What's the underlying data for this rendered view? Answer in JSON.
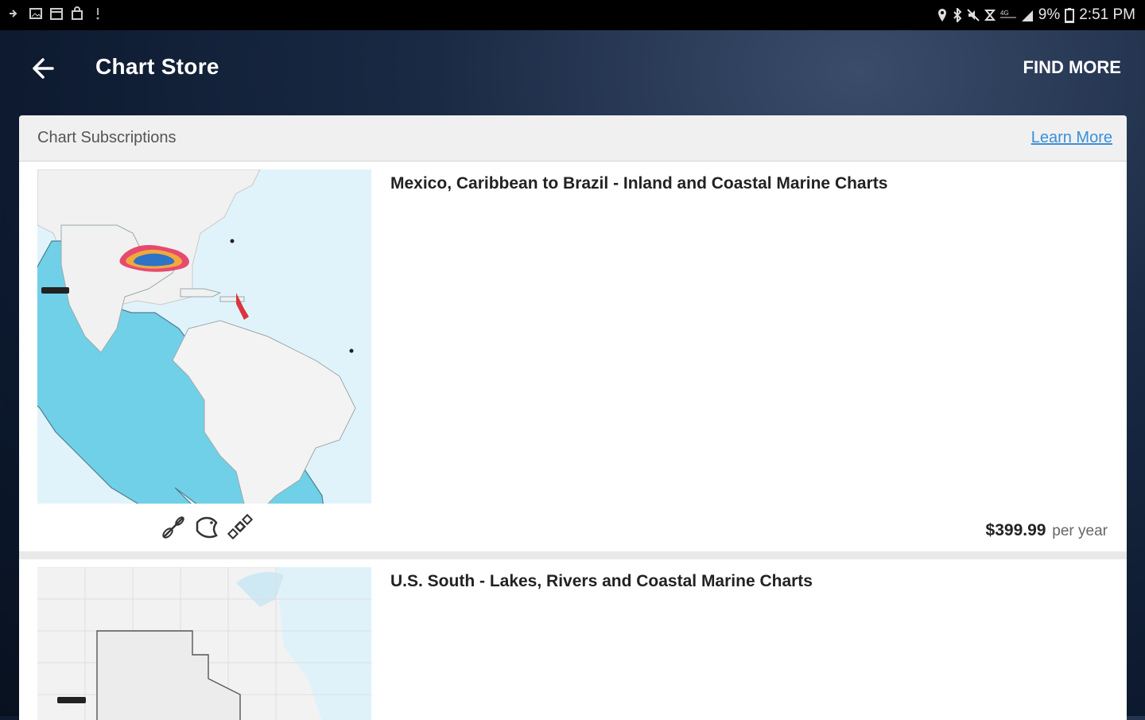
{
  "status_bar": {
    "battery": "9%",
    "time": "2:51 PM"
  },
  "app_bar": {
    "title": "Chart Store",
    "action": "FIND MORE"
  },
  "section": {
    "label": "Chart Subscriptions",
    "link": "Learn More"
  },
  "products": [
    {
      "title": "Mexico, Caribbean to Brazil - Inland and Coastal Marine Charts",
      "price": "$399.99",
      "period": "per year",
      "feature_icons": [
        "paddle-icon",
        "fish-icon",
        "satellite-icon"
      ]
    },
    {
      "title": "U.S. South - Lakes, Rivers and Coastal Marine Charts"
    }
  ]
}
